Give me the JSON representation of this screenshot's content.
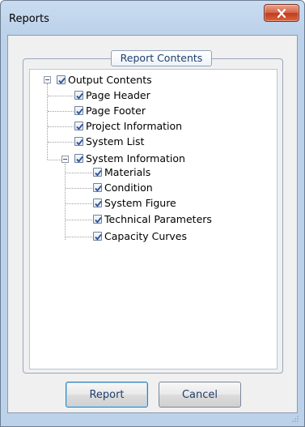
{
  "window": {
    "title": "Reports",
    "close_icon": "close-icon"
  },
  "group": {
    "legend": "Report Contents"
  },
  "tree": {
    "root": {
      "label": "Output Contents",
      "checked": true,
      "expanded": true,
      "children": [
        {
          "label": "Page Header",
          "checked": true
        },
        {
          "label": "Page Footer",
          "checked": true
        },
        {
          "label": "Project Information",
          "checked": true
        },
        {
          "label": "System List",
          "checked": true
        },
        {
          "label": "System Information",
          "checked": true,
          "expanded": true,
          "children": [
            {
              "label": "Materials",
              "checked": true
            },
            {
              "label": "Condition",
              "checked": true
            },
            {
              "label": "System Figure",
              "checked": true
            },
            {
              "label": "Technical Parameters",
              "checked": true
            },
            {
              "label": "Capacity Curves",
              "checked": true
            }
          ]
        }
      ]
    }
  },
  "buttons": {
    "report": "Report",
    "cancel": "Cancel"
  }
}
